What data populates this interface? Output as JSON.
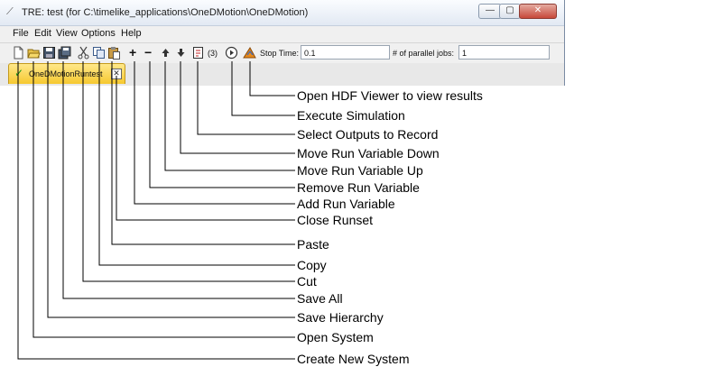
{
  "window": {
    "title": "TRE:  test (for C:\\timelike_applications\\OneDMotion\\OneDMotion)",
    "icon": "tre-app-icon",
    "controls": {
      "minimize": "—",
      "maximize": "▢",
      "close": "✕"
    }
  },
  "menu": [
    "File",
    "Edit",
    "View",
    "Options",
    "Help"
  ],
  "toolbar": {
    "icons": [
      "new-document-icon",
      "open-folder-icon",
      "save-icon",
      "save-all-icon",
      "cut-icon",
      "copy-icon",
      "paste-icon",
      "add-icon",
      "remove-icon",
      "arrow-up-icon",
      "arrow-down-icon",
      "select-outputs-icon",
      "execute-icon",
      "hdf-viewer-icon"
    ],
    "add_symbol": "+",
    "remove_symbol": "−",
    "outputs_count": "(3)",
    "stop_time_label": "Stop Time:",
    "stop_time_value": "0.1",
    "parallel_jobs_label": "# of parallel jobs:",
    "parallel_jobs_value": "1"
  },
  "tab": {
    "label": "OneDMotionRuntest",
    "close": "✕",
    "check": "✓"
  },
  "annotations": [
    "Open HDF Viewer to view results",
    "Execute Simulation",
    "Select Outputs to Record",
    "Move Run Variable Down",
    "Move Run Variable Up",
    "Remove Run Variable",
    "Add Run Variable",
    "Close Runset",
    "Paste",
    "Copy",
    "Cut",
    "Save All",
    "Save Hierarchy",
    "Open System",
    "Create New System"
  ],
  "colors": {
    "tab_active": "#f6c830",
    "close_button": "#c7483a",
    "check": "#1a9a1a"
  }
}
